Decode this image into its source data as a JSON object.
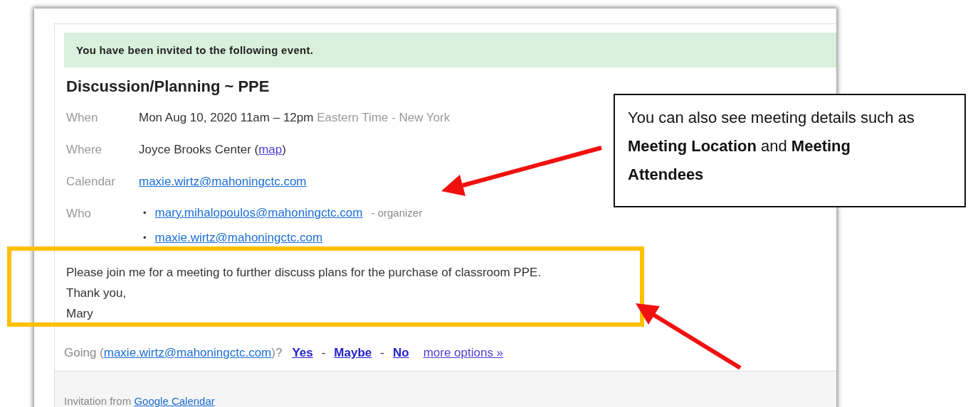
{
  "banner": "You have been invited to the following event.",
  "event_title": "Discussion/Planning ~ PPE",
  "details": [
    {
      "kind": "time",
      "label": "When",
      "value": "Mon Aug 10, 2020 11am – 12pm",
      "note": "Eastern Time - New York"
    },
    {
      "kind": "place",
      "label": "Where",
      "value": "Joyce Brooks Center (",
      "link": "map",
      "after": ")"
    },
    {
      "kind": "link",
      "label": "Calendar",
      "link": "maxie.wirtz@mahoningctc.com"
    },
    {
      "kind": "people",
      "label": "Who",
      "people": [
        {
          "bullet": "•",
          "email": "mary.mihalopoulos@mahoningctc.com",
          "role": "- organizer"
        },
        {
          "bullet": "•",
          "email": "maxie.wirtz@mahoningctc.com"
        }
      ]
    }
  ],
  "message": [
    "Please join me for a meeting to further discuss plans for the purchase of classroom PPE.",
    "Thank you,",
    "Mary"
  ],
  "rsvp": {
    "prompt": "Going (",
    "email": "maxie.wirtz@mahoningctc.com",
    "prompt_end": ")?",
    "options": [
      "Yes",
      "Maybe",
      "No"
    ],
    "separator": "-",
    "more": "more options »"
  },
  "footer": {
    "text": "Invitation from",
    "link": "Google Calendar"
  },
  "callout": "You can also see meeting details such as **Meeting Location** and **Meeting Attendees**"
}
